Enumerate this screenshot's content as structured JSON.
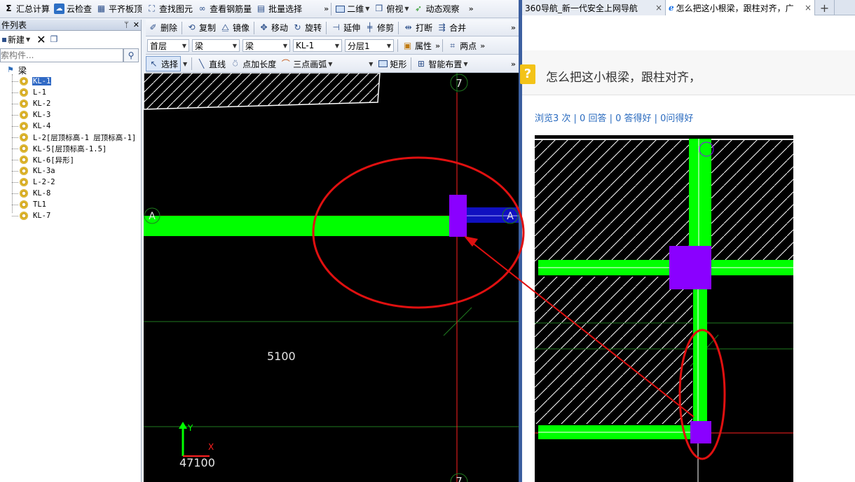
{
  "toolbar_main": {
    "items": [
      {
        "label": "汇总计算",
        "icon": "sum-icon"
      },
      {
        "label": "云检查",
        "icon": "cloud-check-icon"
      },
      {
        "label": "平齐板顶",
        "icon": "align-slab-icon"
      },
      {
        "label": "查找图元",
        "icon": "find-element-icon"
      },
      {
        "label": "查看钢筋量",
        "icon": "rebar-quantity-icon"
      },
      {
        "label": "批量选择",
        "icon": "batch-select-icon"
      }
    ],
    "view_mode": "二维",
    "view_angle": "俯视",
    "dynamic_view": "动态观察",
    "more": "»"
  },
  "panel": {
    "title": "件列表",
    "new_label": "新建",
    "search_placeholder": "索构件...",
    "tree_root": "梁",
    "tree_items": [
      "KL-1",
      "L-1",
      "KL-2",
      "KL-3",
      "KL-4",
      "L-2[层顶标高-1 层顶标高-1]",
      "KL-5[层顶标高-1.5]",
      "KL-6[异形]",
      "KL-3a",
      "L-2-2",
      "KL-8",
      "TL1",
      "KL-7"
    ],
    "selected_index": 0
  },
  "toolbar_edit": {
    "items": [
      "删除",
      "复制",
      "镜像",
      "移动",
      "旋转",
      "延伸",
      "修剪",
      "打断",
      "合并"
    ],
    "more": "»"
  },
  "toolbar_filter": {
    "floor": "首层",
    "category": "梁",
    "type": "梁",
    "component": "KL-1",
    "layer": "分层1",
    "properties": "属性",
    "two_point": "两点",
    "more": "»"
  },
  "toolbar_draw": {
    "select": "选择",
    "line": "直线",
    "point_length": "点加长度",
    "arc": "三点画弧",
    "rect": "矩形",
    "smart": "智能布置",
    "more": "»"
  },
  "canvas": {
    "axis_7": "7",
    "axis_a": "A",
    "dimension": "5100",
    "coord_label": "47100",
    "y_label": "Y",
    "x_label": "X",
    "colors": {
      "beam": "#00ff00",
      "column": "#8a00ff",
      "beam_blue": "#1010c0",
      "axis_red": "#ff2020",
      "grid_green": "#1f7a1f",
      "highlight": "#e01010"
    }
  },
  "browser": {
    "tabs": [
      {
        "title": "360导航_新一代安全上网导航"
      },
      {
        "title": "怎么把这小根梁，跟柱对齐，广"
      }
    ],
    "new_tab": "+",
    "close": "×",
    "question_icon": "?",
    "question_title": "怎么把这小根梁，跟柱对齐，",
    "stats": "浏览3 次 | 0 回答 | 0 答得好 | 0问得好"
  }
}
